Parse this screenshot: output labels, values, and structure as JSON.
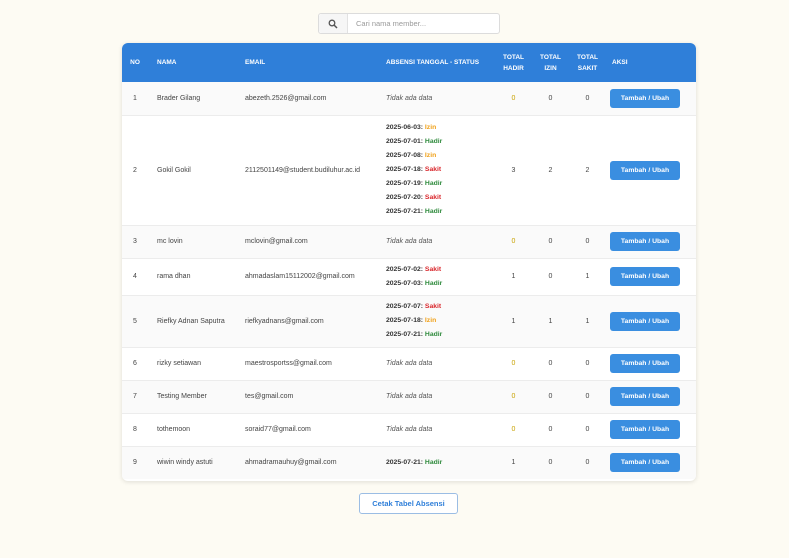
{
  "search": {
    "placeholder": "Cari nama member..."
  },
  "table": {
    "headers": {
      "no": "NO",
      "nama": "NAMA",
      "email": "EMAIL",
      "absensi": "ABSENSI TANGGAL - STATUS",
      "hadir": [
        "TOTAL",
        "HADIR"
      ],
      "izin": [
        "TOTAL",
        "IZIN"
      ],
      "sakit": [
        "TOTAL",
        "SAKIT"
      ],
      "aksi": "AKSI"
    },
    "action_label": "Tambah / Ubah",
    "no_data_label": "Tidak ada data",
    "rows": [
      {
        "no": "1",
        "nama": "Brader Gilang",
        "email": "abezeth.2526@gmail.com",
        "absensi": [],
        "hadir": "0",
        "izin": "0",
        "sakit": "0"
      },
      {
        "no": "2",
        "nama": "Gokil Gokil",
        "email": "2112501149@student.budiluhur.ac.id",
        "absensi": [
          {
            "date": "2025-06-03:",
            "status": "Izin"
          },
          {
            "date": "2025-07-01:",
            "status": "Hadir"
          },
          {
            "date": "2025-07-08:",
            "status": "Izin"
          },
          {
            "date": "2025-07-18:",
            "status": "Sakit"
          },
          {
            "date": "2025-07-19:",
            "status": "Hadir"
          },
          {
            "date": "2025-07-20:",
            "status": "Sakit"
          },
          {
            "date": "2025-07-21:",
            "status": "Hadir"
          }
        ],
        "hadir": "3",
        "izin": "2",
        "sakit": "2"
      },
      {
        "no": "3",
        "nama": "mc lovin",
        "email": "mclovin@gmail.com",
        "absensi": [],
        "hadir": "0",
        "izin": "0",
        "sakit": "0"
      },
      {
        "no": "4",
        "nama": "rama dhan",
        "email": "ahmadaslam15112002@gmail.com",
        "absensi": [
          {
            "date": "2025-07-02:",
            "status": "Sakit"
          },
          {
            "date": "2025-07-03:",
            "status": "Hadir"
          }
        ],
        "hadir": "1",
        "izin": "0",
        "sakit": "1"
      },
      {
        "no": "5",
        "nama": "Riefky Adnan Saputra",
        "email": "riefkyadnans@gmail.com",
        "absensi": [
          {
            "date": "2025-07-07:",
            "status": "Sakit"
          },
          {
            "date": "2025-07-18:",
            "status": "Izin"
          },
          {
            "date": "2025-07-21:",
            "status": "Hadir"
          }
        ],
        "hadir": "1",
        "izin": "1",
        "sakit": "1"
      },
      {
        "no": "6",
        "nama": "rizky setiawan",
        "email": "maestrosportss@gmail.com",
        "absensi": [],
        "hadir": "0",
        "izin": "0",
        "sakit": "0"
      },
      {
        "no": "7",
        "nama": "Testing Member",
        "email": "tes@gmail.com",
        "absensi": [],
        "hadir": "0",
        "izin": "0",
        "sakit": "0"
      },
      {
        "no": "8",
        "nama": "tothemoon",
        "email": "soraid77@gmail.com",
        "absensi": [],
        "hadir": "0",
        "izin": "0",
        "sakit": "0"
      },
      {
        "no": "9",
        "nama": "wiwin windy astuti",
        "email": "ahmadramauhuy@gmail.com",
        "absensi": [
          {
            "date": "2025-07-21:",
            "status": "Hadir"
          }
        ],
        "hadir": "1",
        "izin": "0",
        "sakit": "0"
      }
    ]
  },
  "print_label": "Cetak Tabel Absensi",
  "colors": {
    "header": "#2f7fd9",
    "button": "#3a8ee0",
    "izin": "#f0a018",
    "sakit": "#d9262b",
    "hadir": "#2e8a3c"
  },
  "icons": {
    "search": "search-icon"
  }
}
